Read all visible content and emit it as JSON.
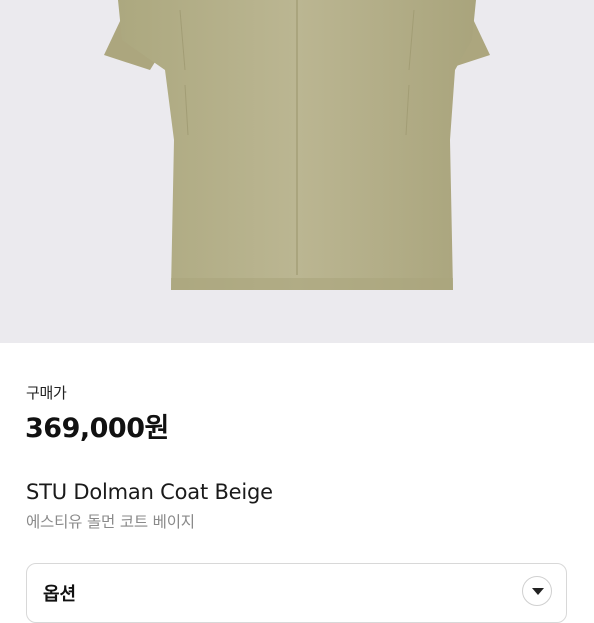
{
  "product": {
    "price_label": "구매가",
    "price": "369,000원",
    "name_en": "STU Dolman Coat Beige",
    "name_ko": "에스티유 돌먼 코트 베이지"
  },
  "option": {
    "label": "옵션"
  },
  "image": {
    "background_color": "#ebeaee",
    "coat_color": "#b9b490"
  }
}
